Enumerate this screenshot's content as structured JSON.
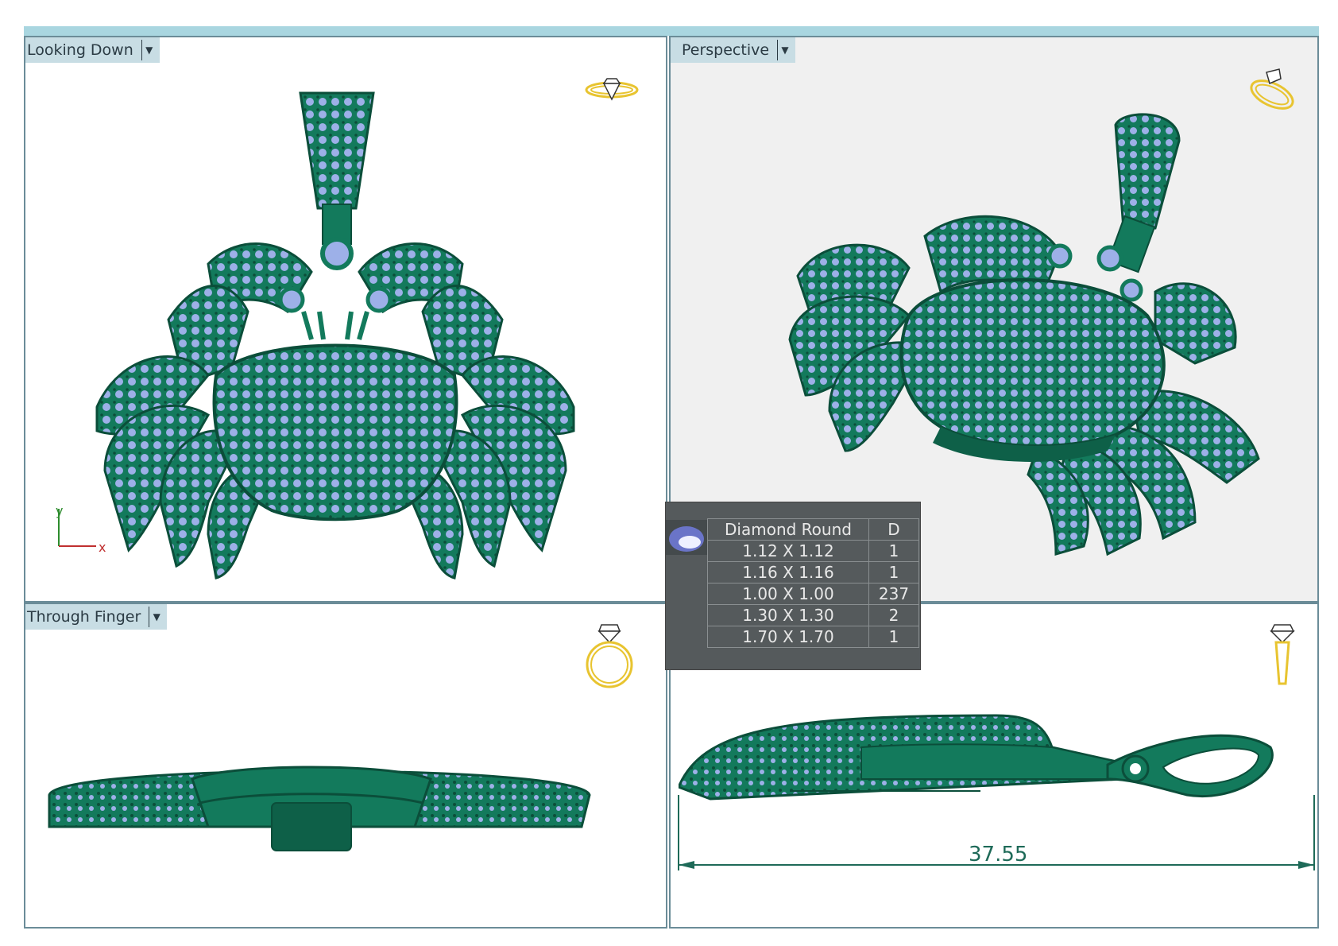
{
  "viewports": {
    "top_left": {
      "title": "Looking Down"
    },
    "top_right": {
      "title": "Perspective"
    },
    "bottom_left": {
      "title": "Through Finger"
    }
  },
  "axis": {
    "x_label": "x",
    "y_label": "y"
  },
  "stone_table": {
    "header": {
      "name": "Diamond Round",
      "count": "D"
    },
    "rows": [
      {
        "size": "1.12 X 1.12",
        "count": "1"
      },
      {
        "size": "1.16 X 1.16",
        "count": "1"
      },
      {
        "size": "1.00 X 1.00",
        "count": "237"
      },
      {
        "size": "1.30 X 1.30",
        "count": "2"
      },
      {
        "size": "1.70 X 1.70",
        "count": "1"
      }
    ]
  },
  "dimension": {
    "length": "37.55"
  },
  "colors": {
    "metal": "#137a5c",
    "metal_dark": "#0b4e3a",
    "stone": "#9db0e8",
    "icon": "#e8c430",
    "dimension_line": "#1e6a58"
  },
  "icons": [
    "ring-top-view-icon",
    "ring-perspective-icon",
    "ring-front-view-icon",
    "ring-side-view-icon"
  ]
}
